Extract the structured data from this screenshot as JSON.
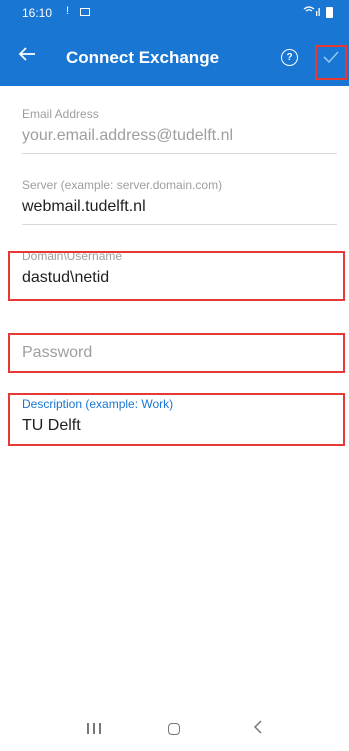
{
  "status_bar": {
    "time": "16:10",
    "notification_icon": "exclamation-icon",
    "image_icon": "gallery-icon",
    "wifi_icon": "wifi-signal-icon",
    "battery_icon": "battery-icon"
  },
  "app_bar": {
    "title": "Connect Exchange",
    "back_icon": "arrow-left-icon",
    "help_icon": "question-circle-icon",
    "help_glyph": "?",
    "done_icon": "checkmark-icon",
    "background_color": "#1976d2"
  },
  "form": {
    "email": {
      "label": "Email Address",
      "placeholder": "your.email.address@tudelft.nl"
    },
    "server": {
      "label": "Server (example: server.domain.com)",
      "value": "webmail.tudelft.nl"
    },
    "username": {
      "label": "Domain\\Username",
      "value": "dastud\\netid"
    },
    "password": {
      "placeholder": "Password"
    },
    "description": {
      "label": "Description (example: Work)",
      "value": "TU Delft",
      "focused": true
    }
  },
  "highlight_color": "#e53935",
  "nav_bar": {
    "recent_icon": "recent-apps-icon",
    "home_icon": "home-icon",
    "back_icon": "chevron-left-icon"
  }
}
